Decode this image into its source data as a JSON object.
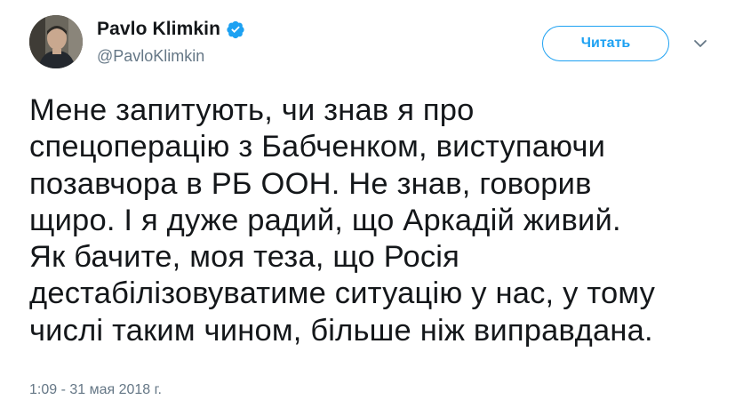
{
  "author": {
    "display_name": "Pavlo Klimkin",
    "handle": "@PavloKlimkin",
    "verified": true
  },
  "follow_button": {
    "label": "Читать"
  },
  "tweet": {
    "lines": [
      "Мене запитують, чи знав я про",
      "спецоперацію з Бабченком, виступаючи",
      "позавчора в РБ ООН. Не знав, говорив",
      "щиро. І я дуже радий, що Аркадій живий.",
      "Як бачите, моя теза, що Росія",
      "дестабілізовуватиме ситуацію у нас, у тому",
      "числі таким чином, більше ніж виправдана."
    ],
    "timestamp": "1:09 - 31 мая 2018 г."
  },
  "icons": {
    "verified": "verified-badge-icon",
    "caret": "chevron-down-icon"
  },
  "colors": {
    "accent": "#1da1f2",
    "text": "#14171a",
    "secondary": "#657786"
  }
}
